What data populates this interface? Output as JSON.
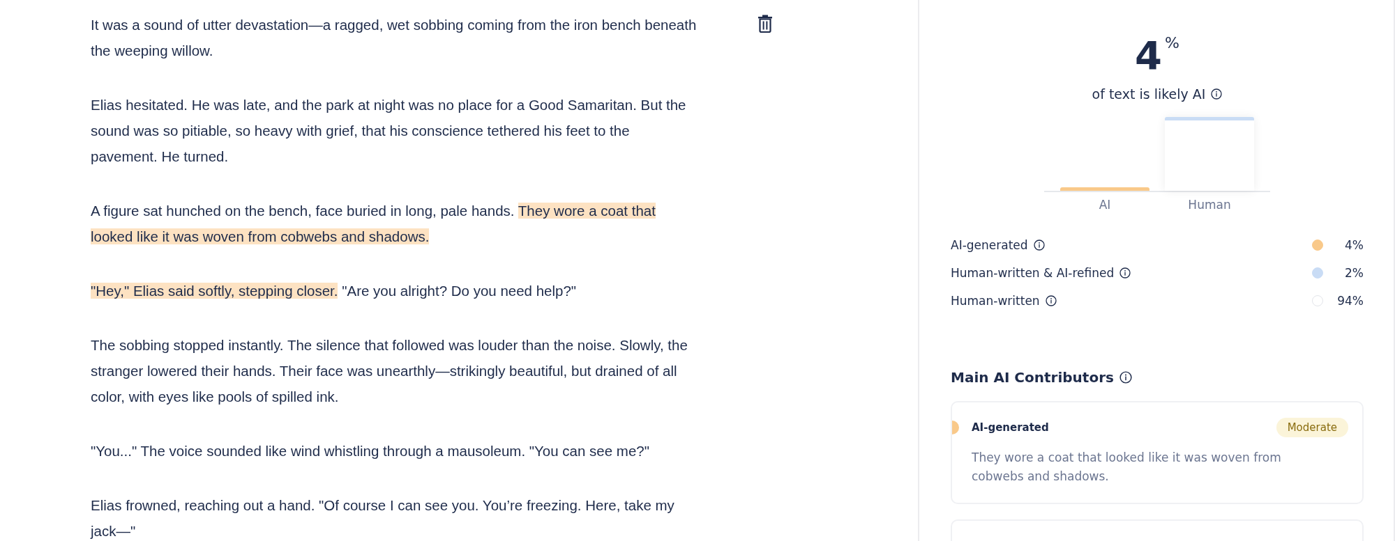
{
  "document": {
    "paragraphs": [
      {
        "segments": [
          {
            "text": "It was a sound of utter devastation—a ragged, wet sobbing coming from the iron bench beneath the weeping willow.",
            "highlighted": false
          }
        ]
      },
      {
        "segments": [
          {
            "text": "Elias hesitated. He was late, and the park at night was no place for a Good Samaritan. But the sound was so pitiable, so heavy with grief, that his conscience tethered his feet to the pavement. He turned.",
            "highlighted": false
          }
        ]
      },
      {
        "segments": [
          {
            "text": "A figure sat hunched on the bench, face buried in long, pale hands. ",
            "highlighted": false
          },
          {
            "text": "They wore a coat that looked like it was woven from cobwebs and shadows.",
            "highlighted": true
          }
        ]
      },
      {
        "segments": [
          {
            "text": "\"Hey,\" Elias said softly, stepping closer.",
            "highlighted": true
          },
          {
            "text": " \"Are you alright? Do you need help?\"",
            "highlighted": false
          }
        ]
      },
      {
        "segments": [
          {
            "text": "The sobbing stopped instantly. The silence that followed was louder than the noise. Slowly, the stranger lowered their hands. Their face was unearthly—strikingly beautiful, but drained of all color, with eyes like pools of spilled ink.",
            "highlighted": false
          }
        ]
      },
      {
        "segments": [
          {
            "text": "\"You...\" The voice sounded like wind whistling through a mausoleum. \"You can see me?\"",
            "highlighted": false
          }
        ]
      },
      {
        "segments": [
          {
            "text": "Elias frowned, reaching out a hand. \"Of course I can see you. You’re freezing. Here, take my jack—\"",
            "highlighted": false
          }
        ]
      }
    ]
  },
  "summary": {
    "score": "4",
    "unit": "%",
    "caption": "of text is likely AI",
    "chart_categories": [
      "AI",
      "Human"
    ],
    "legend": [
      {
        "label": "AI-generated",
        "value": "4%",
        "color": "#f9c98a"
      },
      {
        "label": "Human-written & AI-refined",
        "value": "2%",
        "color": "#c9dcf5"
      },
      {
        "label": "Human-written",
        "value": "94%",
        "color": "#ffffff"
      }
    ]
  },
  "contributors": {
    "title": "Main AI Contributors",
    "items": [
      {
        "label": "AI-generated",
        "badge": "Moderate",
        "color": "#f9c98a",
        "text": "They wore a coat that looked like it was woven from cobwebs and shadows."
      }
    ]
  }
}
